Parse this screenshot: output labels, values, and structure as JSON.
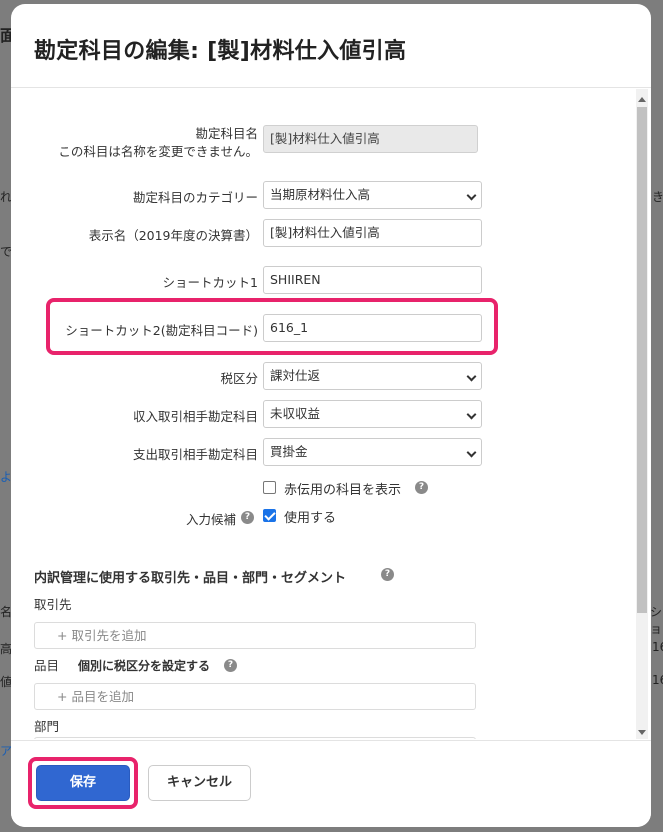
{
  "background_fragments": {
    "b1": "面",
    "b2": "れ",
    "b3": "で",
    "b4": "き",
    "b5": "よ",
    "b6": "名",
    "b7": "高",
    "b8": "値",
    "b9": "ショ",
    "b10": "16",
    "b11": "16",
    "b12": "ア"
  },
  "modal": {
    "title": "勘定科目の編集: [製]材料仕入値引高"
  },
  "form": {
    "account_name_label": "勘定科目名",
    "account_name_note": "この科目は名称を変更できません。",
    "account_name_value": "[製]材料仕入値引高",
    "category_label": "勘定科目のカテゴリー",
    "category_value": "当期原材料仕入高",
    "display_name_label": "表示名（2019年度の決算書）",
    "display_name_value": "[製]材料仕入値引高",
    "shortcut1_label": "ショートカット1",
    "shortcut1_value": "SHIIREN",
    "shortcut2_label": "ショートカット2(勘定科目コード)",
    "shortcut2_value": "616_1",
    "tax_label": "税区分",
    "tax_value": "課対仕返",
    "income_label": "収入取引相手勘定科目",
    "income_value": "未収収益",
    "expense_label": "支出取引相手勘定科目",
    "expense_value": "買掛金",
    "red_slip_label": "赤伝用の科目を表示",
    "input_candidate_label": "入力候補",
    "use_label": "使用する"
  },
  "breakdown": {
    "title": "内訳管理に使用する取引先・品目・部門・セグメント",
    "partner_label": "取引先",
    "partner_add": "+ 取引先を追加",
    "item_label": "品目",
    "item_tax_label": "個別に税区分を設定する",
    "item_add": "+ 品目を追加",
    "department_label": "部門"
  },
  "footer": {
    "save_label": "保存",
    "cancel_label": "キャンセル"
  },
  "icons": {
    "help_glyph": "?"
  },
  "colors": {
    "highlight": "#e8236b",
    "primary": "#3067d1",
    "checkbox": "#1a73e8"
  }
}
